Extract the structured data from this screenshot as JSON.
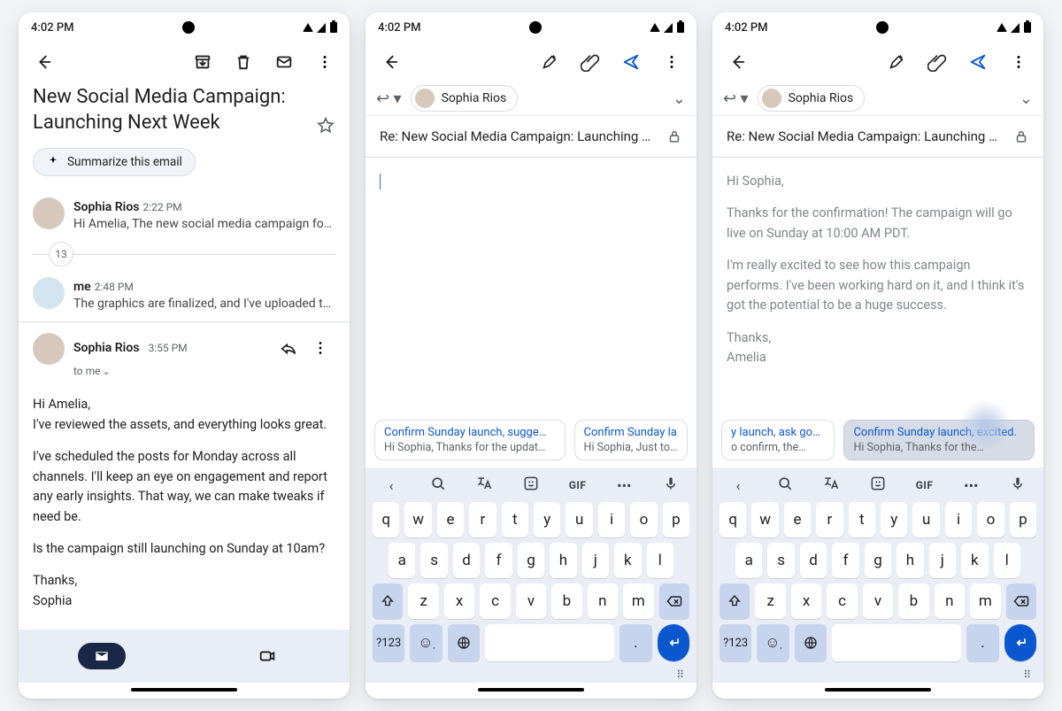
{
  "status": {
    "time": "4:02 PM"
  },
  "thread": {
    "subject": "New Social Media Campaign: Launching Next Week",
    "summarize_chip": "Summarize this email",
    "collapsed_count": "13",
    "msgs": [
      {
        "from": "Sophia Rios",
        "time": "2:22 PM",
        "snippet": "Hi Amelia, The new social media campaign for ou…"
      },
      {
        "from": "me",
        "time": "2:48 PM",
        "snippet": "The graphics are finalized, and I've uploaded the…"
      }
    ],
    "expanded": {
      "from": "Sophia Rios",
      "time": "3:55 PM",
      "to": "to me",
      "body": [
        "Hi Amelia,",
        "I've reviewed the assets, and everything looks great.",
        "I've scheduled the posts for Monday across all channels. I'll keep an eye on engagement and report any early insights. That way, we can make tweaks if need be.",
        "Is the campaign still launching on Sunday at 10am?",
        "Thanks,",
        "Sophia"
      ]
    }
  },
  "compose": {
    "recipient": "Sophia Rios",
    "subject": "Re: New Social Media Campaign: Launching N…",
    "suggestions_a": [
      {
        "title": "Confirm Sunday launch, sugge…",
        "sub": "Hi Sophia, Thanks for the updat…"
      },
      {
        "title": "Confirm Sunday la",
        "sub": "Hi Sophia, Just to c"
      }
    ],
    "draft_body": [
      "Hi Sophia,",
      "Thanks for the confirmation! The campaign will go live on Sunday at 10:00 AM PDT.",
      "I'm really excited to see how this campaign performs. I've been working hard on it, and I think it's got the potential to be a huge success.",
      "Thanks,",
      "Amelia"
    ],
    "suggestions_b": [
      {
        "title": "y launch, ask goals",
        "sub": "o confirm, the…"
      },
      {
        "title": "Confirm Sunday launch, excited.",
        "sub": "Hi Sophia, Thanks for the…"
      }
    ]
  },
  "keyboard": {
    "row1": [
      "q",
      "w",
      "e",
      "r",
      "t",
      "y",
      "u",
      "i",
      "o",
      "p"
    ],
    "row2": [
      "a",
      "s",
      "d",
      "f",
      "g",
      "h",
      "j",
      "k",
      "l"
    ],
    "row3": [
      "z",
      "x",
      "c",
      "v",
      "b",
      "n",
      "m"
    ],
    "sym": "?123",
    "gif": "GIF"
  }
}
